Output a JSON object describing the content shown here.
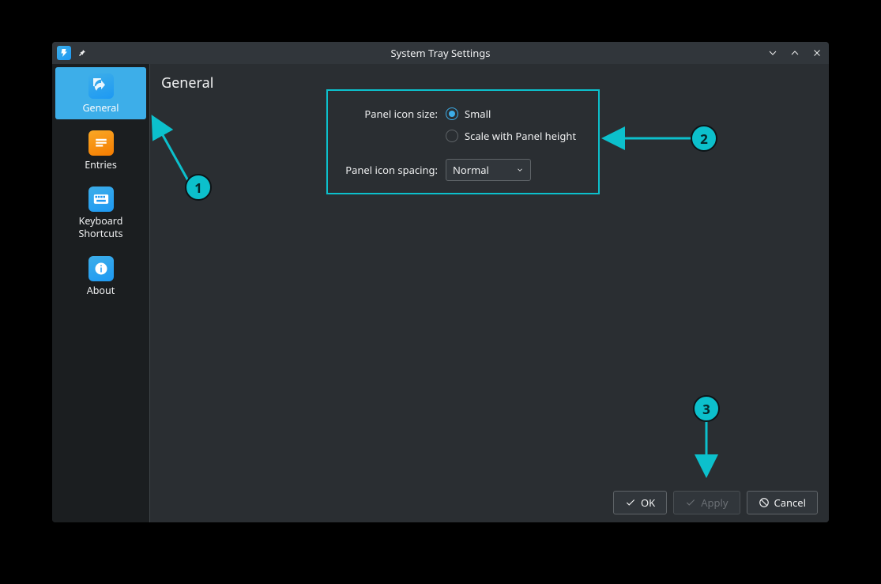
{
  "titlebar": {
    "title": "System Tray Settings"
  },
  "sidebar": {
    "items": [
      {
        "label": "General"
      },
      {
        "label": "Entries"
      },
      {
        "label": "Keyboard\nShortcuts"
      },
      {
        "label": "About"
      }
    ]
  },
  "main": {
    "heading": "General",
    "icon_size_label": "Panel icon size:",
    "icon_size_option_small": "Small",
    "icon_size_option_scale": "Scale with Panel height",
    "icon_spacing_label": "Panel icon spacing:",
    "icon_spacing_value": "Normal"
  },
  "buttons": {
    "ok": "OK",
    "apply": "Apply",
    "cancel": "Cancel"
  },
  "annotations": {
    "badge1": "1",
    "badge2": "2",
    "badge3": "3"
  }
}
